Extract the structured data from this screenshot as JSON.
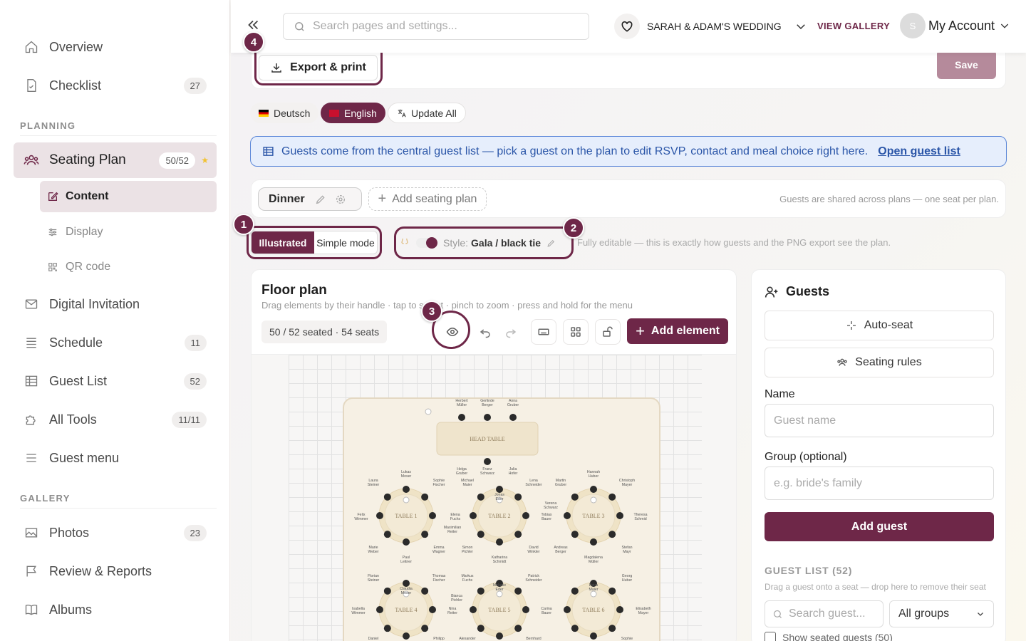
{
  "sidebar": {
    "items": [
      {
        "label": "Overview",
        "icon": "home-icon"
      },
      {
        "label": "Checklist",
        "icon": "checklist-icon",
        "badge": "27"
      },
      {
        "label": "Seating Plan",
        "icon": "people-icon",
        "badge": "50/52"
      },
      {
        "label": "Digital Invitation",
        "icon": "mail-icon"
      },
      {
        "label": "Schedule",
        "icon": "list-icon",
        "badge": "11"
      },
      {
        "label": "Guest List",
        "icon": "table-icon",
        "badge": "52"
      },
      {
        "label": "All Tools",
        "icon": "puzzle-icon",
        "badge": "11/11"
      },
      {
        "label": "Guest menu",
        "icon": "menu-icon"
      },
      {
        "label": "Photos",
        "icon": "image-icon",
        "badge": "23"
      },
      {
        "label": "Review & Reports",
        "icon": "flag-icon"
      },
      {
        "label": "Albums",
        "icon": "book-icon"
      }
    ],
    "sections": {
      "planning": "PLANNING",
      "gallery": "GALLERY"
    },
    "sub_items": [
      {
        "label": "Content",
        "icon": "edit-icon"
      },
      {
        "label": "Display",
        "icon": "sliders-icon"
      },
      {
        "label": "QR code",
        "icon": "qr-icon"
      }
    ],
    "star": "★"
  },
  "header": {
    "search_placeholder": "Search pages and settings...",
    "wedding": "SARAH & ADAM'S WEDDING",
    "view_gallery": "VIEW GALLERY",
    "avatar": "S",
    "account": "My Account"
  },
  "toolbar": {
    "export": "Export & print",
    "save": "Save"
  },
  "markers": [
    "1",
    "2",
    "3",
    "4"
  ],
  "languages": {
    "deutsch": "Deutsch",
    "english": "English",
    "update_all": "Update All"
  },
  "banner": {
    "text": "Guests come from the central guest list — pick a guest on the plan to edit RSVP, contact and meal choice right here.",
    "link": "Open guest list"
  },
  "plans": {
    "tab": "Dinner",
    "add": "Add seating plan",
    "note": "Guests are shared across plans — one seat per plan."
  },
  "modes": {
    "illustrated": "Illustrated",
    "simple": "Simple mode",
    "style_label": "Style:",
    "style_value": "Gala / black tie",
    "note": "Fully editable — this is exactly how guests and the PNG export see the plan."
  },
  "floor": {
    "title": "Floor plan",
    "subtitle": "Drag elements by their handle · tap to select · pinch to zoom · press and hold for the menu",
    "seated": "50 / 52 seated · 54 seats",
    "add_element": "Add element",
    "head_table": "HEAD TABLE",
    "tables": [
      {
        "label": "TABLE 1"
      },
      {
        "label": "TABLE 2"
      },
      {
        "label": "TABLE 3"
      },
      {
        "label": "TABLE 4"
      },
      {
        "label": "TABLE 5"
      },
      {
        "label": "TABLE 6"
      }
    ],
    "guest_labels": [
      {
        "text": "Herbert Müller"
      },
      {
        "text": "Gerlinde Berger"
      },
      {
        "text": "Anna Gruber"
      },
      {
        "text": "Helga Gruber"
      },
      {
        "text": "Franz Schwarz"
      },
      {
        "text": "Julia Hofer"
      },
      {
        "text": "Lukas Moser"
      },
      {
        "text": "Laura Steiner"
      },
      {
        "text": "Sophie Fischer"
      },
      {
        "text": "Michael Maier"
      },
      {
        "text": "Lena Schneider"
      },
      {
        "text": "Martin Gruber"
      },
      {
        "text": "Hannah Huber"
      },
      {
        "text": "Christoph Mayer"
      },
      {
        "text": "Felix Wimmer"
      },
      {
        "text": "Elena Fuchs"
      },
      {
        "text": "Jonas Eder"
      },
      {
        "text": "Verena Schwarz"
      },
      {
        "text": "Tobias Bauer"
      },
      {
        "text": "Theresa Schmid"
      },
      {
        "text": "Maximilian Reiter"
      },
      {
        "text": "Marie Weber"
      },
      {
        "text": "Emma Wagner"
      },
      {
        "text": "Simon Pichler"
      },
      {
        "text": "David Winkler"
      },
      {
        "text": "Andreas Berger"
      },
      {
        "text": "Stefan Mayr"
      },
      {
        "text": "Paul Leitner"
      },
      {
        "text": "Katharina Schmidt"
      },
      {
        "text": "Magdalena Müller"
      },
      {
        "text": "Florian Steiner"
      },
      {
        "text": "Thomas Fischer"
      },
      {
        "text": "Markus Fuchs"
      },
      {
        "text": "Patrick Schneider"
      },
      {
        "text": "Georg Huber"
      },
      {
        "text": "Claudia Moser"
      },
      {
        "text": "Melanie Eder"
      },
      {
        "text": "Petra Maier"
      },
      {
        "text": "Bianca Pichler"
      },
      {
        "text": "Isabella Wimmer"
      },
      {
        "text": "Nina Reiter"
      },
      {
        "text": "Carina Bauer"
      },
      {
        "text": "Elisabeth Mayer"
      },
      {
        "text": "Daniel"
      },
      {
        "text": "Philipp"
      },
      {
        "text": "Alexander"
      },
      {
        "text": "Bernhard"
      },
      {
        "text": "Sophie"
      }
    ]
  },
  "guests": {
    "title": "Guests",
    "auto_seat": "Auto-seat",
    "rules": "Seating rules",
    "name_label": "Name",
    "name_placeholder": "Guest name",
    "group_label": "Group (optional)",
    "group_placeholder": "e.g. bride's family",
    "add_guest": "Add guest",
    "list_title": "GUEST LIST (52)",
    "list_sub": "Drag a guest onto a seat — drop here to remove their seat",
    "search_placeholder": "Search guest...",
    "group_filter": "All groups",
    "show_seated": "Show seated guests (50)"
  }
}
